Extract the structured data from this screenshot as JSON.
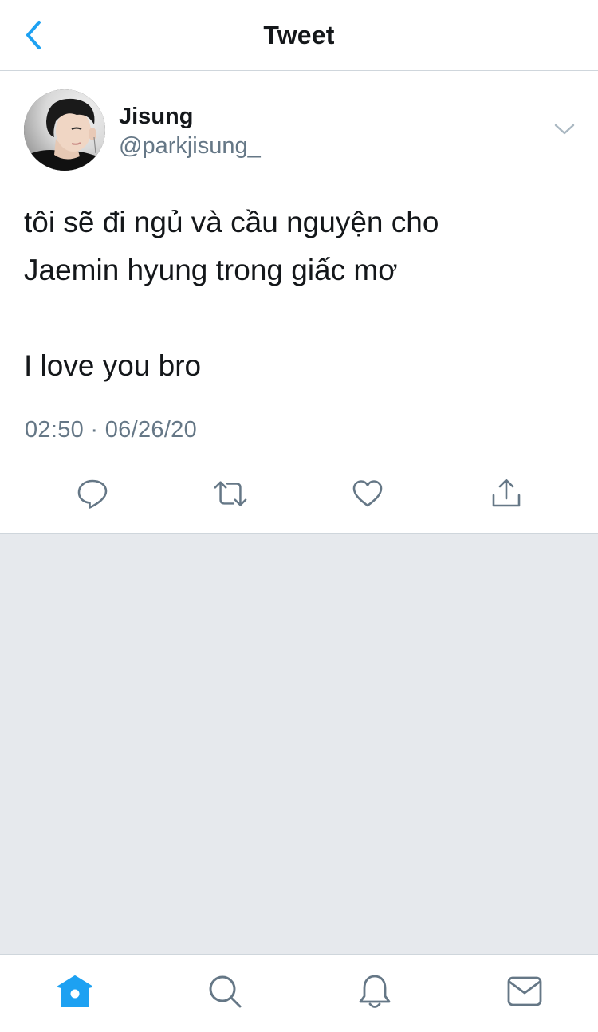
{
  "header": {
    "title": "Tweet",
    "back_icon": "chevron-left-icon"
  },
  "tweet": {
    "author": {
      "display_name": "Jisung",
      "handle": "@parkjisung_"
    },
    "text_lines": [
      "tôi sẽ đi ngủ và cầu nguyện cho",
      "Jaemin hyung trong giấc mơ",
      "",
      "I love you bro"
    ],
    "timestamp": "02:50 · 06/26/20",
    "actions": [
      "reply-icon",
      "retweet-icon",
      "like-icon",
      "share-icon"
    ]
  },
  "tabbar": {
    "tabs": [
      "home-icon",
      "search-icon",
      "notifications-icon",
      "messages-icon"
    ],
    "active": "home-icon"
  },
  "colors": {
    "accent": "#1da1f2",
    "icon_gray": "#657786",
    "background_gray": "#e6e9ed"
  }
}
